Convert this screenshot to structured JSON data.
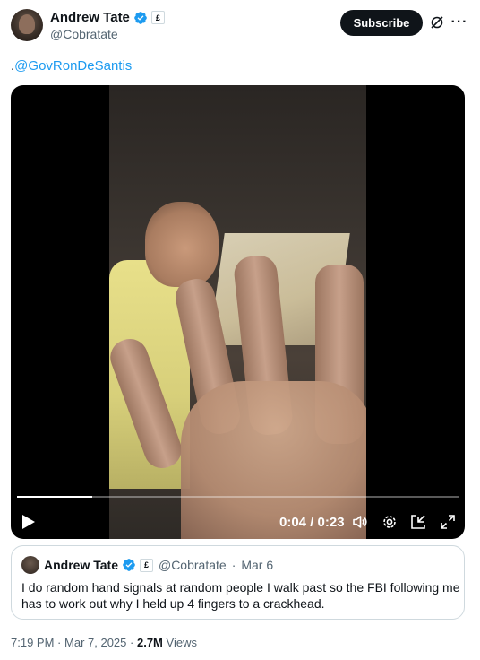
{
  "post": {
    "author": {
      "display_name": "Andrew Tate",
      "handle": "@Cobratate",
      "avatar_icon": "avatar",
      "verified_icon": "verified-badge-icon",
      "affiliation_badge": "£"
    },
    "subscribe_label": "Subscribe",
    "text_prefix": ".",
    "mention": "@GovRonDeSantis",
    "accent_color": "#1d9bf0"
  },
  "video": {
    "current_time": "0:04",
    "separator": "/",
    "duration": "0:23",
    "progress_fraction": 0.17
  },
  "quoted_post": {
    "display_name": "Andrew Tate",
    "affiliation_badge": "£",
    "handle": "@Cobratate",
    "separator": "·",
    "date": "Mar 6",
    "text": "I do random hand signals at random people I walk past so the FBI following me has to work out why I held up 4 fingers to a crackhead."
  },
  "meta": {
    "time": "7:19 PM",
    "dot": "·",
    "date": "Mar 7, 2025",
    "views_count": "2.7M",
    "views_label": "Views"
  }
}
